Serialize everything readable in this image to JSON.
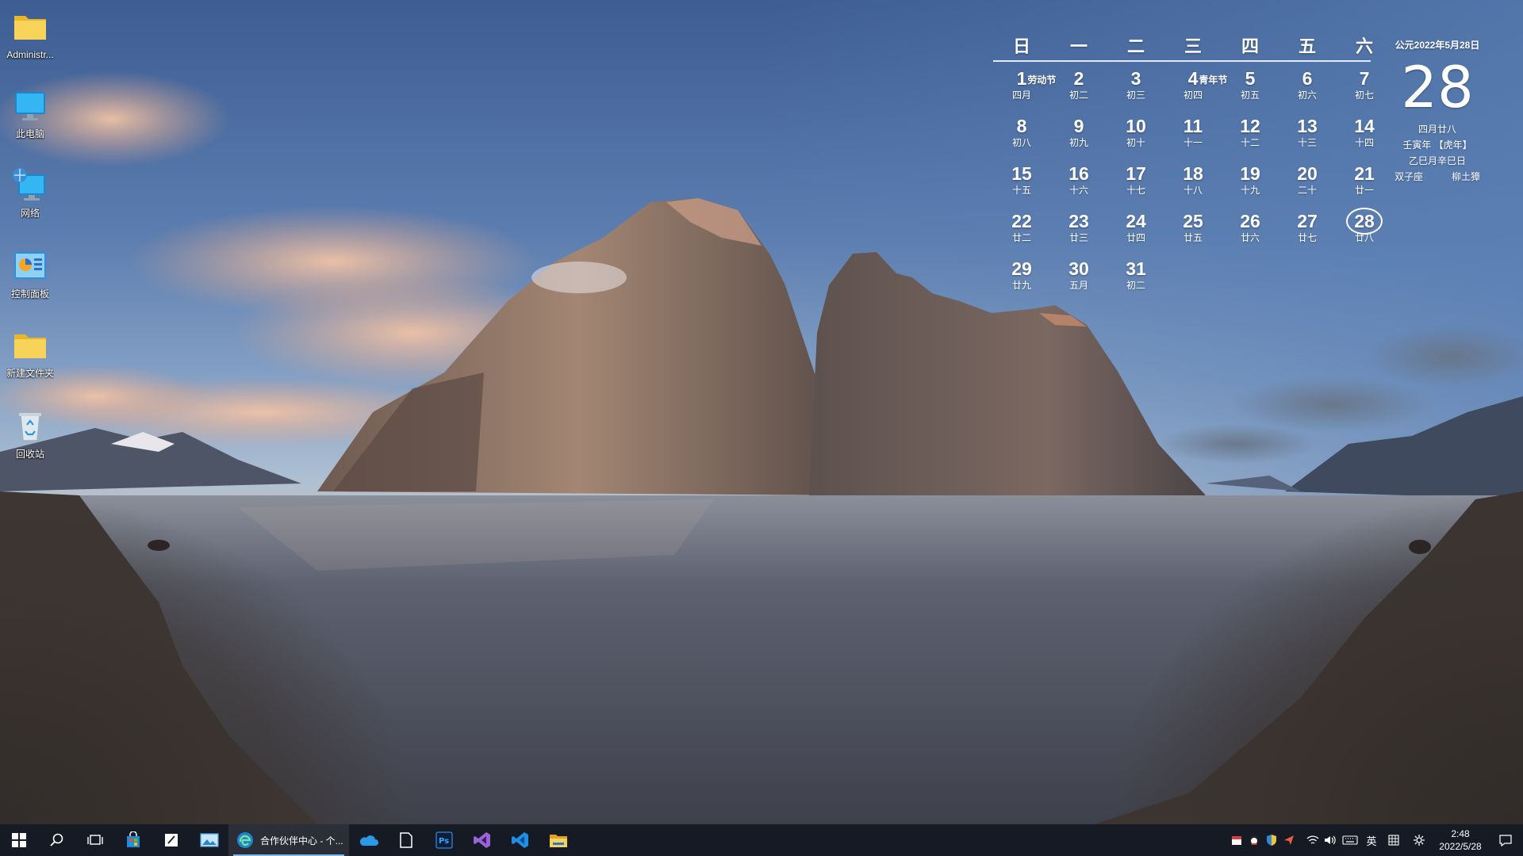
{
  "desktop": {
    "icons": [
      {
        "name": "administrator-folder",
        "label": "Administr...",
        "icon": "folder-icon"
      },
      {
        "name": "this-pc",
        "label": "此电脑",
        "icon": "monitor-icon"
      },
      {
        "name": "network",
        "label": "网络",
        "icon": "network-icon"
      },
      {
        "name": "control-panel",
        "label": "控制面板",
        "icon": "control-panel-icon"
      },
      {
        "name": "new-folder",
        "label": "新建文件夹",
        "icon": "folder-icon"
      },
      {
        "name": "recycle-bin",
        "label": "回收站",
        "icon": "recycle-bin-icon"
      }
    ]
  },
  "calendar": {
    "weekdays": [
      "日",
      "一",
      "二",
      "三",
      "四",
      "五",
      "六"
    ],
    "days": [
      {
        "d": "1",
        "fest": "劳动节",
        "lunar": "四月"
      },
      {
        "d": "2",
        "lunar": "初二"
      },
      {
        "d": "3",
        "lunar": "初三"
      },
      {
        "d": "4",
        "fest": "青年节",
        "lunar": "初四"
      },
      {
        "d": "5",
        "lunar": "初五"
      },
      {
        "d": "6",
        "lunar": "初六"
      },
      {
        "d": "7",
        "lunar": "初七"
      },
      {
        "d": "8",
        "lunar": "初八"
      },
      {
        "d": "9",
        "lunar": "初九"
      },
      {
        "d": "10",
        "lunar": "初十"
      },
      {
        "d": "11",
        "lunar": "十一"
      },
      {
        "d": "12",
        "lunar": "十二"
      },
      {
        "d": "13",
        "lunar": "十三"
      },
      {
        "d": "14",
        "lunar": "十四"
      },
      {
        "d": "15",
        "lunar": "十五"
      },
      {
        "d": "16",
        "lunar": "十六"
      },
      {
        "d": "17",
        "lunar": "十七"
      },
      {
        "d": "18",
        "lunar": "十八"
      },
      {
        "d": "19",
        "lunar": "十九"
      },
      {
        "d": "20",
        "lunar": "二十"
      },
      {
        "d": "21",
        "lunar": "廿一"
      },
      {
        "d": "22",
        "lunar": "廿二"
      },
      {
        "d": "23",
        "lunar": "廿三"
      },
      {
        "d": "24",
        "lunar": "廿四"
      },
      {
        "d": "25",
        "lunar": "廿五"
      },
      {
        "d": "26",
        "lunar": "廿六"
      },
      {
        "d": "27",
        "lunar": "廿七"
      },
      {
        "d": "28",
        "lunar": "廿八",
        "today": true
      },
      {
        "d": "29",
        "lunar": "廿九"
      },
      {
        "d": "30",
        "lunar": "五月"
      },
      {
        "d": "31",
        "lunar": "初二"
      }
    ]
  },
  "today": {
    "ad_date": "公元2022年5月28日",
    "day": "28",
    "lunar_date": "四月廿八",
    "year_ganzhi": "壬寅年 【虎年】",
    "month_day_ganzhi": "乙巳月辛巳日",
    "constellation": "双子座",
    "lunar_mansion": "柳土獐"
  },
  "taskbar": {
    "edge_title": "合作伙伴中心 - 个...",
    "ime_label": "英",
    "clock_time": "2:48",
    "clock_date": "2022/5/28",
    "accent": "#76b9ed",
    "apps": [
      "start-icon",
      "search-icon",
      "task-view-icon",
      "store-icon",
      "sticky-notes-icon",
      "photos-icon",
      "edge-icon",
      "onedrive-icon",
      "file-icon",
      "photoshop-icon",
      "visual-studio-icon",
      "vscode-icon",
      "file-explorer-icon"
    ]
  }
}
